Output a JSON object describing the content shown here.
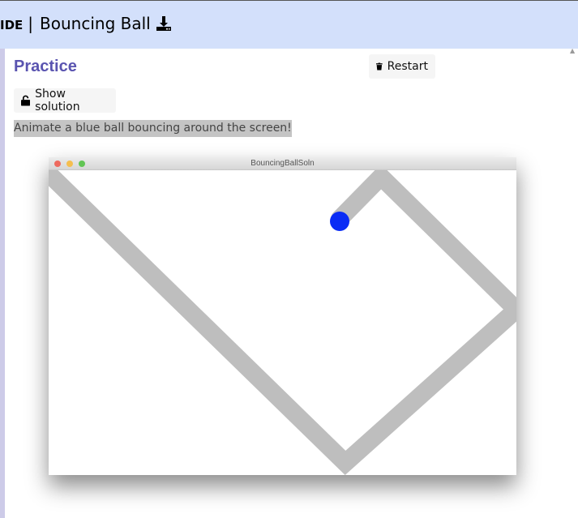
{
  "header": {
    "prefix": "IDE",
    "separator": "|",
    "title": "Bouncing Ball",
    "download_icon": "download-icon"
  },
  "exercise": {
    "section_title": "Practice",
    "restart_label": "Restart",
    "restart_icon": "trash-icon",
    "show_solution_label": "Show solution",
    "show_solution_icon": "unlock-icon",
    "prompt": "Animate a blue ball bouncing around the screen!"
  },
  "program_window": {
    "title": "BouncingBallSoln",
    "ball_color": "#0a2cf5",
    "trail_color": "#bebebe"
  },
  "colors": {
    "header_bg": "#d3e0fb",
    "accent": "#5a54b0",
    "left_strip": "#cdcbe8"
  }
}
